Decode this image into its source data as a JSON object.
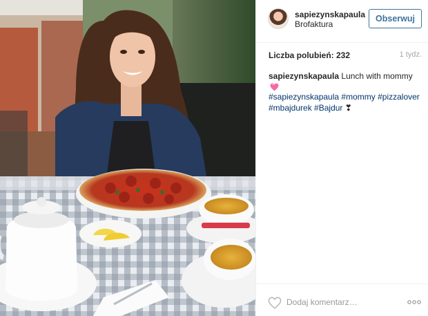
{
  "header": {
    "username": "sapiezynskapaula",
    "location": "Brofaktura",
    "follow_label": "Obserwuj"
  },
  "meta": {
    "likes_text": "Liczba polubień: 232",
    "time_ago": "1 tydz."
  },
  "caption": {
    "username": "sapiezynskapaula",
    "text": "Lunch with mommy"
  },
  "hashtags": [
    "#sapiezynskapaula",
    "#mommy",
    "#pizzalover",
    "#mbajdurek",
    "#Bajdur"
  ],
  "hashtag_suffix": "❣",
  "footer": {
    "comment_placeholder": "Dodaj komentarz…"
  },
  "colors": {
    "follow_blue": "#3f729b",
    "hashtag_blue": "#003569",
    "muted_gray": "#a5a7aa",
    "heart_pink": "#f56ca5"
  },
  "icons": {
    "like": "heart-outline-icon",
    "more": "more-options-icon",
    "caption_emoji": "pink-heart-emoji-icon"
  }
}
